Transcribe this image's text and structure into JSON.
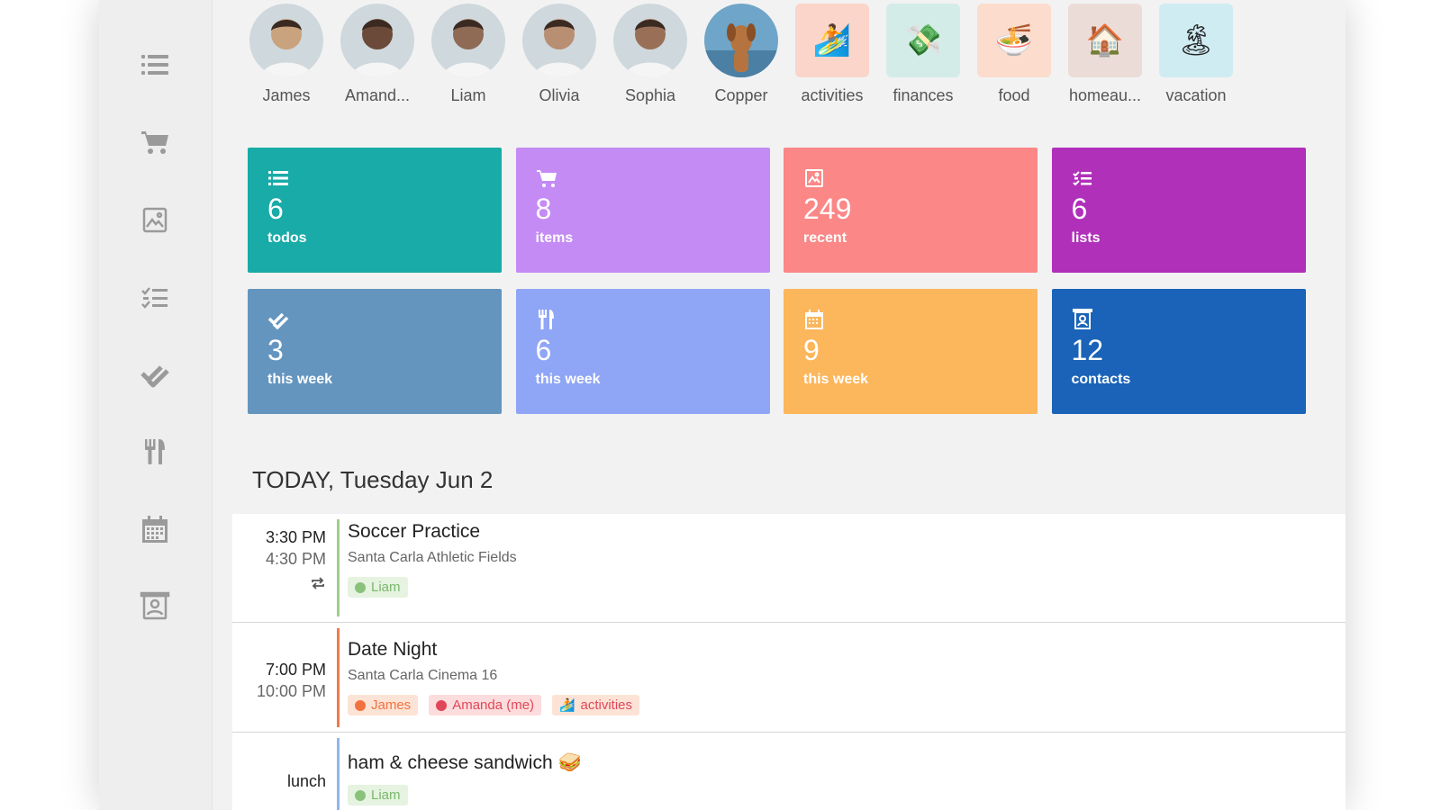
{
  "avatars": [
    {
      "name": "James",
      "kind": "person",
      "color": "#c9a27e"
    },
    {
      "name": "Amand...",
      "kind": "person",
      "color": "#6b4a3a"
    },
    {
      "name": "Liam",
      "kind": "person",
      "color": "#8f6a55"
    },
    {
      "name": "Olivia",
      "kind": "person",
      "color": "#b98f73"
    },
    {
      "name": "Sophia",
      "kind": "person",
      "color": "#9a6f58"
    },
    {
      "name": "Copper",
      "kind": "pet",
      "color": "#b5743f"
    },
    {
      "name": "activities",
      "kind": "category",
      "emoji": "🏄",
      "bg": "#fbd5c9"
    },
    {
      "name": "finances",
      "kind": "category",
      "emoji": "💸",
      "bg": "#d3ece8"
    },
    {
      "name": "food",
      "kind": "category",
      "emoji": "🍜",
      "bg": "#fbdccd"
    },
    {
      "name": "homeau...",
      "kind": "category",
      "emoji": "🏠",
      "bg": "#ecdcd8"
    },
    {
      "name": "vacation",
      "kind": "category",
      "emoji": "🏝",
      "bg": "#d0ecf3"
    }
  ],
  "tiles": [
    {
      "num": "6",
      "label": "todos",
      "color": "#19aba7",
      "icon": "list-icon"
    },
    {
      "num": "8",
      "label": "items",
      "color": "#c48bf5",
      "icon": "cart-icon"
    },
    {
      "num": "249",
      "label": "recent",
      "color": "#fb8787",
      "icon": "photo-icon"
    },
    {
      "num": "6",
      "label": "lists",
      "color": "#b030ba",
      "icon": "checklist-icon"
    },
    {
      "num": "3",
      "label": "this week",
      "color": "#6495bf",
      "icon": "double-check-icon"
    },
    {
      "num": "6",
      "label": "this week",
      "color": "#8fa5f5",
      "icon": "utensils-icon"
    },
    {
      "num": "9",
      "label": "this week",
      "color": "#fcb65c",
      "icon": "calendar-icon"
    },
    {
      "num": "12",
      "label": "contacts",
      "color": "#1a63b8",
      "icon": "contact-icon"
    }
  ],
  "today": {
    "heading": "TODAY, Tuesday Jun 2"
  },
  "events": [
    {
      "start": "3:30 PM",
      "end": "4:30 PM",
      "repeat": true,
      "title": "Soccer Practice",
      "location": "Santa Carla Athletic Fields",
      "bar_color": "#9ccf8e",
      "tags": [
        {
          "label": "Liam",
          "bg": "#e5f3e0",
          "fg": "#7ab86c",
          "dot": "#8ac27c"
        }
      ]
    },
    {
      "start": "7:00 PM",
      "end": "10:00 PM",
      "repeat": false,
      "title": "Date Night",
      "location": "Santa Carla Cinema 16",
      "bar_color": "#f07a4a",
      "tags": [
        {
          "label": "James",
          "bg": "#fde3d6",
          "fg": "#f0733f",
          "dot": "#f0733f"
        },
        {
          "label": "Amanda (me)",
          "bg": "#fcdcdc",
          "fg": "#e0485a",
          "dot": "#e0485a"
        },
        {
          "label": "activities",
          "bg": "#fde3d6",
          "fg": "#e0485a",
          "dot": "",
          "emoji": "🏄"
        }
      ]
    },
    {
      "start": "lunch",
      "end": "",
      "repeat": false,
      "title": "ham & cheese sandwich 🥪",
      "location": "",
      "bar_color": "#8fb8e8",
      "tags": [
        {
          "label": "Liam",
          "bg": "#e5f3e0",
          "fg": "#7ab86c",
          "dot": "#8ac27c"
        }
      ]
    }
  ]
}
